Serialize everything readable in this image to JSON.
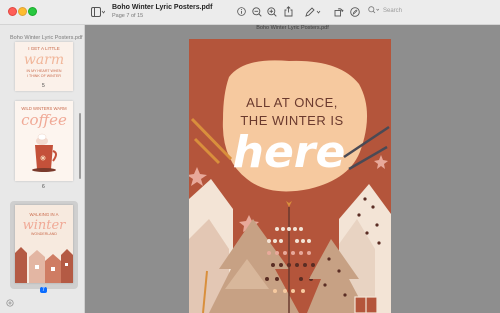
{
  "window": {
    "title": "Boho Winter Lyric Posters.pdf",
    "subtitle": "Page 7 of 15",
    "search_placeholder": "Search"
  },
  "toolbar": {
    "icons": [
      "sidebar-toggle-icon",
      "info-icon",
      "zoom-out-icon",
      "zoom-in-icon",
      "share-icon",
      "markup-icon",
      "rotate-icon",
      "annotate-icon",
      "search-icon"
    ]
  },
  "sidebar": {
    "header": "Boho Winter Lyric Posters.pdf",
    "pages": [
      {
        "number": "5",
        "text_lines": [
          "I GET A LITTLE",
          "warm",
          "IN MY HEART WHEN",
          "I THINK OF WINTER"
        ]
      },
      {
        "number": "6",
        "text_lines": [
          "WILD WINTERS WARM",
          "coffee"
        ]
      },
      {
        "number": "7",
        "text_lines": [
          "WALKING IN A",
          "winter",
          "WONDERLAND"
        ],
        "selected": true
      }
    ]
  },
  "main": {
    "caption": "Boho Winter Lyric Posters.pdf",
    "poster": {
      "line1": "ALL AT ONCE,",
      "line2": "THE WINTER IS",
      "script_word": "here",
      "colors": {
        "background": "#b4553b",
        "sun": "#f6c99f",
        "cream": "#f3e4d6",
        "pink": "#e8a99a",
        "tan": "#c7a184",
        "dark": "#5a2d24"
      }
    }
  }
}
